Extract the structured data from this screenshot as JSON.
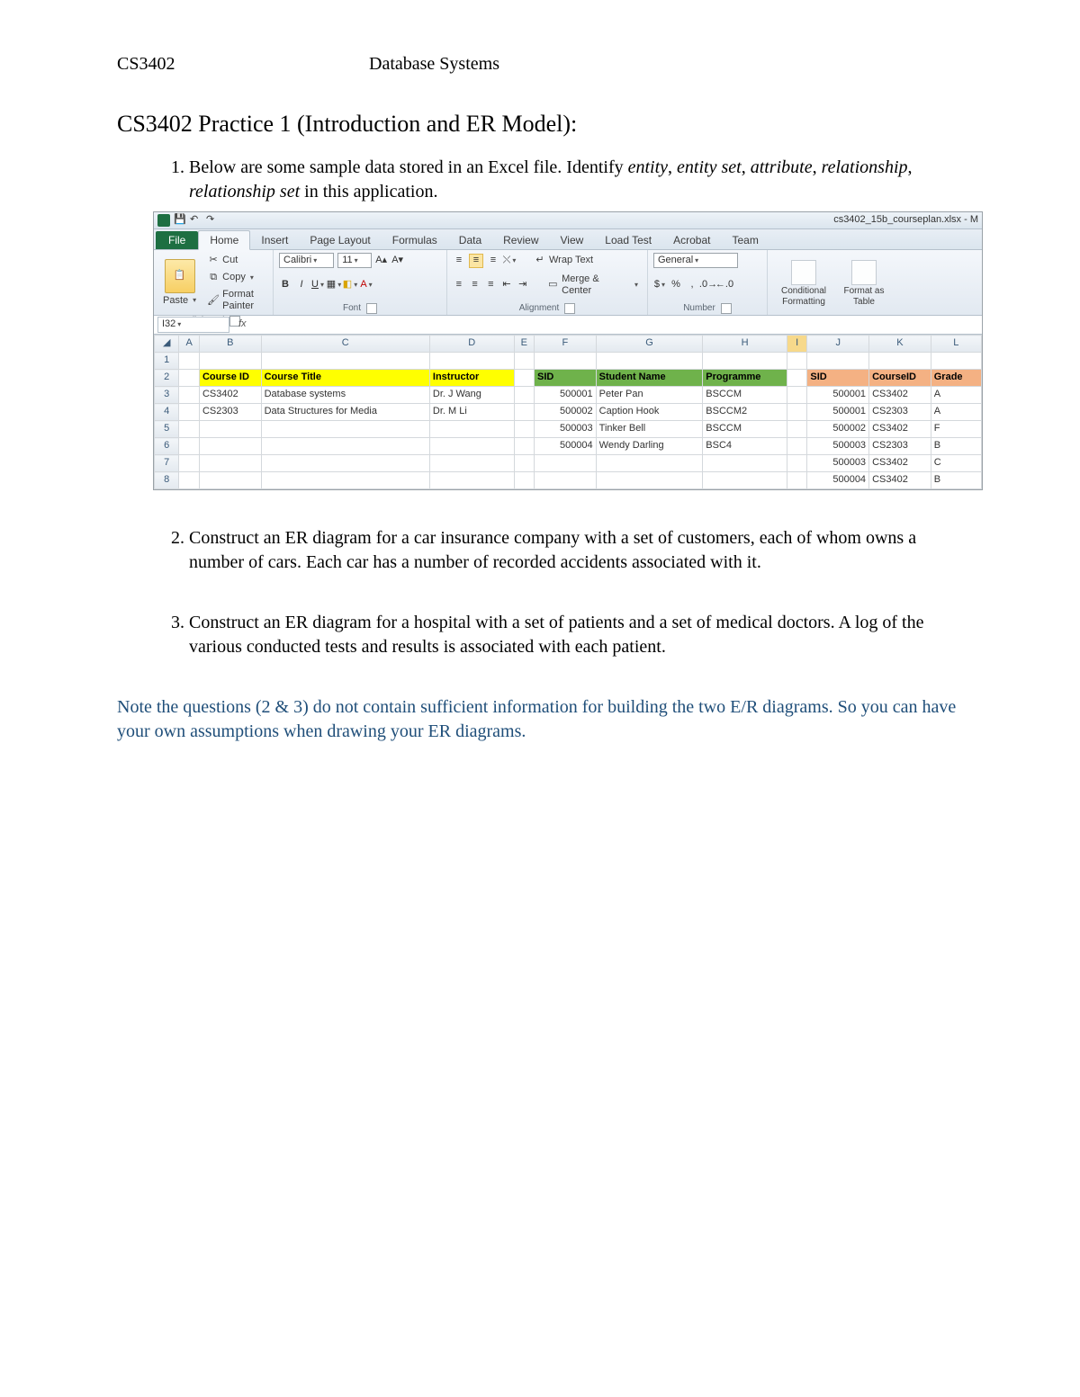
{
  "doc": {
    "code": "CS3402",
    "course": "Database Systems",
    "title": "CS3402 Practice 1 (Introduction and ER Model):",
    "q1_a": "Below are some sample data stored in an Excel file. Identify ",
    "q1_b": ", ",
    "q1_c": " in this application.",
    "terms": {
      "entity": "entity",
      "entity_set": "entity set",
      "attribute": "attribute",
      "relationship": "relationship",
      "relationship_set": "relationship set"
    },
    "q2": "Construct an ER diagram for a car insurance company with a set of customers, each of whom owns a number of cars. Each car has a number of recorded accidents associated with it.",
    "q3": "Construct an ER diagram for a hospital with a set of patients and a set of medical doctors. A log of the various conducted tests and results is associated with each patient.",
    "note": "Note the questions (2 & 3) do not contain sufficient information for building the two E/R diagrams. So you can have your own assumptions when drawing your ER diagrams."
  },
  "excel": {
    "filename": "cs3402_15b_courseplan.xlsx - M",
    "tabs": [
      "File",
      "Home",
      "Insert",
      "Page Layout",
      "Formulas",
      "Data",
      "Review",
      "View",
      "Load Test",
      "Acrobat",
      "Team"
    ],
    "clipboard": {
      "paste": "Paste",
      "cut": "Cut",
      "copy": "Copy",
      "fmt": "Format Painter",
      "label": "Clipboard"
    },
    "font": {
      "name": "Calibri",
      "size": "11",
      "label": "Font"
    },
    "alignment": {
      "wrap": "Wrap Text",
      "merge": "Merge & Center",
      "label": "Alignment"
    },
    "number": {
      "fmt": "General",
      "label": "Number"
    },
    "styles": {
      "cond": "Conditional Formatting",
      "tbl": "Format as Table"
    },
    "namebox": "I32",
    "cols": [
      "A",
      "B",
      "C",
      "D",
      "E",
      "F",
      "G",
      "H",
      "I",
      "J",
      "K",
      "L"
    ],
    "headers1": {
      "B": "Course ID",
      "C": "Course Title",
      "D": "Instructor"
    },
    "headers2": {
      "F": "SID",
      "G": "Student Name",
      "H": "Programme"
    },
    "headers3": {
      "J": "SID",
      "K": "CourseID",
      "L": "Grade"
    },
    "t1": [
      {
        "B": "CS3402",
        "C": "Database systems",
        "D": "Dr. J Wang"
      },
      {
        "B": "CS2303",
        "C": "Data Structures for Media",
        "D": "Dr. M Li"
      }
    ],
    "t2": [
      {
        "F": "500001",
        "G": "Peter Pan",
        "H": "BSCCM"
      },
      {
        "F": "500002",
        "G": "Caption Hook",
        "H": "BSCCM2"
      },
      {
        "F": "500003",
        "G": "Tinker Bell",
        "H": "BSCCM"
      },
      {
        "F": "500004",
        "G": "Wendy Darling",
        "H": "BSC4"
      }
    ],
    "t3": [
      {
        "J": "500001",
        "K": "CS3402",
        "L": "A"
      },
      {
        "J": "500001",
        "K": "CS2303",
        "L": "A"
      },
      {
        "J": "500002",
        "K": "CS3402",
        "L": "F"
      },
      {
        "J": "500003",
        "K": "CS2303",
        "L": "B"
      },
      {
        "J": "500003",
        "K": "CS3402",
        "L": "C"
      },
      {
        "J": "500004",
        "K": "CS3402",
        "L": "B"
      }
    ]
  }
}
